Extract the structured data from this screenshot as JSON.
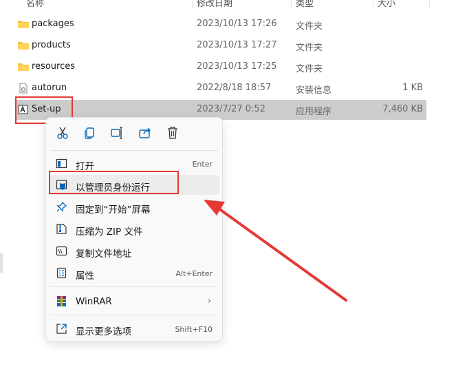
{
  "columns": {
    "name": "名称",
    "date": "修改日期",
    "type": "类型",
    "size": "大小"
  },
  "files": [
    {
      "name": "packages",
      "date": "2023/10/13 17:26",
      "type": "文件夹",
      "size": "",
      "icon": "folder-icon"
    },
    {
      "name": "products",
      "date": "2023/10/13 17:27",
      "type": "文件夹",
      "size": "",
      "icon": "folder-icon"
    },
    {
      "name": "resources",
      "date": "2023/10/13 17:25",
      "type": "文件夹",
      "size": "",
      "icon": "folder-icon"
    },
    {
      "name": "autorun",
      "date": "2022/8/18 18:57",
      "type": "安装信息",
      "size": "1 KB",
      "icon": "setup-info-file-icon"
    },
    {
      "name": "Set-up",
      "date": "2023/7/27 0:52",
      "type": "应用程序",
      "size": "7,460 KB",
      "icon": "adobe-app-icon"
    }
  ],
  "context_menu": {
    "toolbar": [
      "cut-icon",
      "copy-icon",
      "rename-icon",
      "share-icon",
      "delete-icon"
    ],
    "items": [
      {
        "label": "打开",
        "shortcut": "Enter",
        "icon": "open-icon"
      },
      {
        "label": "以管理员身份运行",
        "shortcut": "",
        "icon": "admin-shield-icon"
      },
      {
        "label": "固定到“开始”屏幕",
        "shortcut": "",
        "icon": "pin-icon"
      },
      {
        "label": "压缩为 ZIP 文件",
        "shortcut": "",
        "icon": "zip-icon"
      },
      {
        "label": "复制文件地址",
        "shortcut": "",
        "icon": "copy-path-icon"
      },
      {
        "label": "属性",
        "shortcut": "Alt+Enter",
        "icon": "properties-icon"
      },
      {
        "label": "WinRAR",
        "shortcut": "",
        "icon": "winrar-icon",
        "submenu": true
      },
      {
        "label": "显示更多选项",
        "shortcut": "Shift+F10",
        "icon": "more-options-icon"
      }
    ]
  },
  "colors": {
    "annotation": "#e53935",
    "selected_row": "#cccccc",
    "accent": "#0067c0",
    "folder": "#f5c542"
  }
}
